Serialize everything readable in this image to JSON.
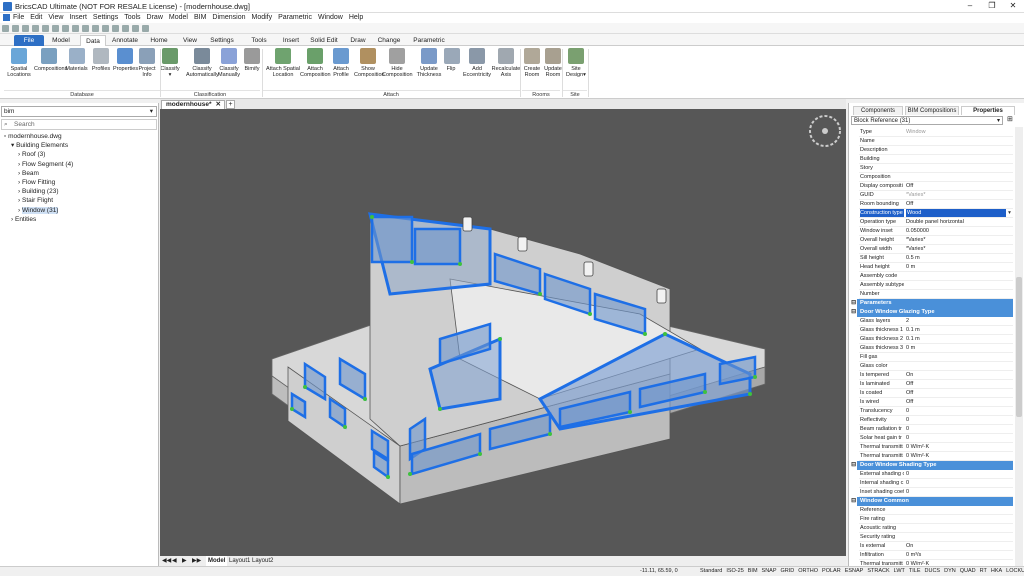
{
  "window": {
    "title": "BricsCAD Ultimate (NOT FOR RESALE License) - [modernhouse.dwg]"
  },
  "menu": [
    "File",
    "Edit",
    "View",
    "Insert",
    "Settings",
    "Tools",
    "Draw",
    "Model",
    "BIM",
    "Dimension",
    "Modify",
    "Parametric",
    "Window",
    "Help"
  ],
  "tabs": [
    "File",
    "Model",
    "Data",
    "Annotate",
    "Home",
    "View",
    "Settings",
    "Tools",
    "Insert",
    "Solid Edit",
    "Draw",
    "Change",
    "Parametric"
  ],
  "ribbon": {
    "buttons": [
      {
        "label": "Spatial\nLocations",
        "color": "#6aa6d8"
      },
      {
        "label": "Compositions",
        "color": "#7aa0c0"
      },
      {
        "label": "Materials",
        "color": "#9ab0c8"
      },
      {
        "label": "Profiles",
        "color": "#b0b8c0"
      },
      {
        "label": "Properties",
        "color": "#5a8fd0"
      },
      {
        "label": "Project\nInfo",
        "color": "#8aa0b8"
      },
      {
        "label": "Classify\n▾",
        "color": "#6a9a6a"
      },
      {
        "label": "Classify\nAutomatically",
        "color": "#7a8a9a"
      },
      {
        "label": "Classify\nManually",
        "color": "#8aa2d8"
      },
      {
        "label": "Bimify",
        "color": "#9a9a9a"
      },
      {
        "label": "Attach Spatial\nLocation",
        "color": "#6fa36f"
      },
      {
        "label": "Attach\nComposition",
        "color": "#6aa06a"
      },
      {
        "label": "Attach\nProfile",
        "color": "#6a9ad0"
      },
      {
        "label": "Show\nComposition",
        "color": "#b09060"
      },
      {
        "label": "Hide\nComposition",
        "color": "#a0a0a0"
      },
      {
        "label": "Update\nThickness",
        "color": "#7a9ac8"
      },
      {
        "label": "Flip",
        "color": "#9aa8b8"
      },
      {
        "label": "Add\nEccentricity",
        "color": "#8a98a8"
      },
      {
        "label": "Recalculate\nAxis",
        "color": "#a0a8b0"
      },
      {
        "label": "Create\nRoom",
        "color": "#b0a898"
      },
      {
        "label": "Update\nRoom",
        "color": "#a8a090"
      },
      {
        "label": "Site\nDesign▾",
        "color": "#7aa070"
      }
    ],
    "groups": [
      "Database",
      "Classification",
      "Attach",
      "Rooms",
      "Site"
    ]
  },
  "left_panel": {
    "select_value": "bim",
    "search_placeholder": "Search",
    "tree": [
      {
        "label": "modernhouse.dwg",
        "indent": 0,
        "prefix": ""
      },
      {
        "label": "Building Elements",
        "indent": 1,
        "prefix": "▾"
      },
      {
        "label": "Roof (3)",
        "indent": 2,
        "prefix": "›"
      },
      {
        "label": "Flow Segment (4)",
        "indent": 2,
        "prefix": "›"
      },
      {
        "label": "Beam",
        "indent": 2,
        "prefix": "›"
      },
      {
        "label": "Flow Fitting",
        "indent": 2,
        "prefix": "›"
      },
      {
        "label": "Building (23)",
        "indent": 2,
        "prefix": "›"
      },
      {
        "label": "Stair Flight",
        "indent": 2,
        "prefix": "›"
      },
      {
        "label": "Window (31)",
        "indent": 2,
        "prefix": "›",
        "selected": true
      },
      {
        "label": "Entities",
        "indent": 1,
        "prefix": "›"
      }
    ]
  },
  "viewport": {
    "tab": "modernhouse*",
    "plus": "+"
  },
  "layout_tabs": [
    "Model",
    "Layout1",
    "Layout2"
  ],
  "right_panel": {
    "tabs": [
      "Components",
      "BIM Compositions",
      "Properties"
    ],
    "block_ref": "Block Reference (31)",
    "rows": [
      {
        "k": "Type",
        "v": "Window",
        "g": true
      },
      {
        "k": "Name",
        "v": ""
      },
      {
        "k": "Description",
        "v": ""
      },
      {
        "k": "Building",
        "v": ""
      },
      {
        "k": "Story",
        "v": ""
      },
      {
        "k": "Composition",
        "v": ""
      },
      {
        "k": "Display compositi",
        "v": "Off"
      },
      {
        "k": "GUID",
        "v": "*Varies*",
        "g": true
      },
      {
        "k": "Room bounding",
        "v": "Off"
      },
      {
        "k": "Construction type",
        "v": "Wood",
        "hl": true
      },
      {
        "k": "Operation type",
        "v": "Double panel horizontal"
      },
      {
        "k": "Window inset",
        "v": "0.050000"
      },
      {
        "k": "Overall height",
        "v": "*Varies*"
      },
      {
        "k": "Overall width",
        "v": "*Varies*"
      },
      {
        "k": "Sill height",
        "v": "0.5 m"
      },
      {
        "k": "Head height",
        "v": "0 m"
      },
      {
        "k": "Assembly code",
        "v": ""
      },
      {
        "k": "Assembly subtype",
        "v": ""
      },
      {
        "k": "Number",
        "v": ""
      },
      {
        "sec": "Parameters"
      },
      {
        "sec": "Door Window Glazing Type"
      },
      {
        "k": "Glass layers",
        "v": "2"
      },
      {
        "k": "Glass thickness 1",
        "v": "0.1 m"
      },
      {
        "k": "Glass thickness 2",
        "v": "0.1 m"
      },
      {
        "k": "Glass thickness 3",
        "v": "0 m"
      },
      {
        "k": "Fill gas",
        "v": ""
      },
      {
        "k": "Glass color",
        "v": ""
      },
      {
        "k": "Is tempered",
        "v": "On"
      },
      {
        "k": "Is laminated",
        "v": "Off"
      },
      {
        "k": "Is coated",
        "v": "Off"
      },
      {
        "k": "Is wired",
        "v": "Off"
      },
      {
        "k": "Translucency",
        "v": "0"
      },
      {
        "k": "Reflectivity",
        "v": "0"
      },
      {
        "k": "Beam radiation tr",
        "v": "0"
      },
      {
        "k": "Solar heat gain tr",
        "v": "0"
      },
      {
        "k": "Thermal transmitt",
        "v": "0 W/m²·K"
      },
      {
        "k": "Thermal transmitt",
        "v": "0 W/m²·K"
      },
      {
        "sec": "Door Window Shading Type"
      },
      {
        "k": "External shading c",
        "v": "0"
      },
      {
        "k": "Internal shading c",
        "v": "0"
      },
      {
        "k": "Inset shading coef",
        "v": "0"
      },
      {
        "sec": "Window Common"
      },
      {
        "k": "Reference",
        "v": ""
      },
      {
        "k": "Fire rating",
        "v": ""
      },
      {
        "k": "Acoustic rating",
        "v": ""
      },
      {
        "k": "Security rating",
        "v": ""
      },
      {
        "k": "Is external",
        "v": "On"
      },
      {
        "k": "Infiltration",
        "v": "0 m³/s"
      },
      {
        "k": "Thermal transmitt",
        "v": "0 W/m²·K"
      }
    ]
  },
  "status": {
    "coords": "-11.11, 65.59, 0",
    "items": [
      "Standard",
      "ISO-25",
      "BIM",
      "SNAP",
      "GRID",
      "ORTHO",
      "POLAR",
      "ESNAP",
      "STRACK",
      "LWT",
      "TILE",
      "DUCS",
      "DYN",
      "QUAD",
      "RT",
      "HKA",
      "LOCKUI",
      "None"
    ]
  },
  "colors": {
    "accent": "#2d6fc5",
    "selection": "#1e6fe6",
    "viewport_bg": "#575757"
  }
}
